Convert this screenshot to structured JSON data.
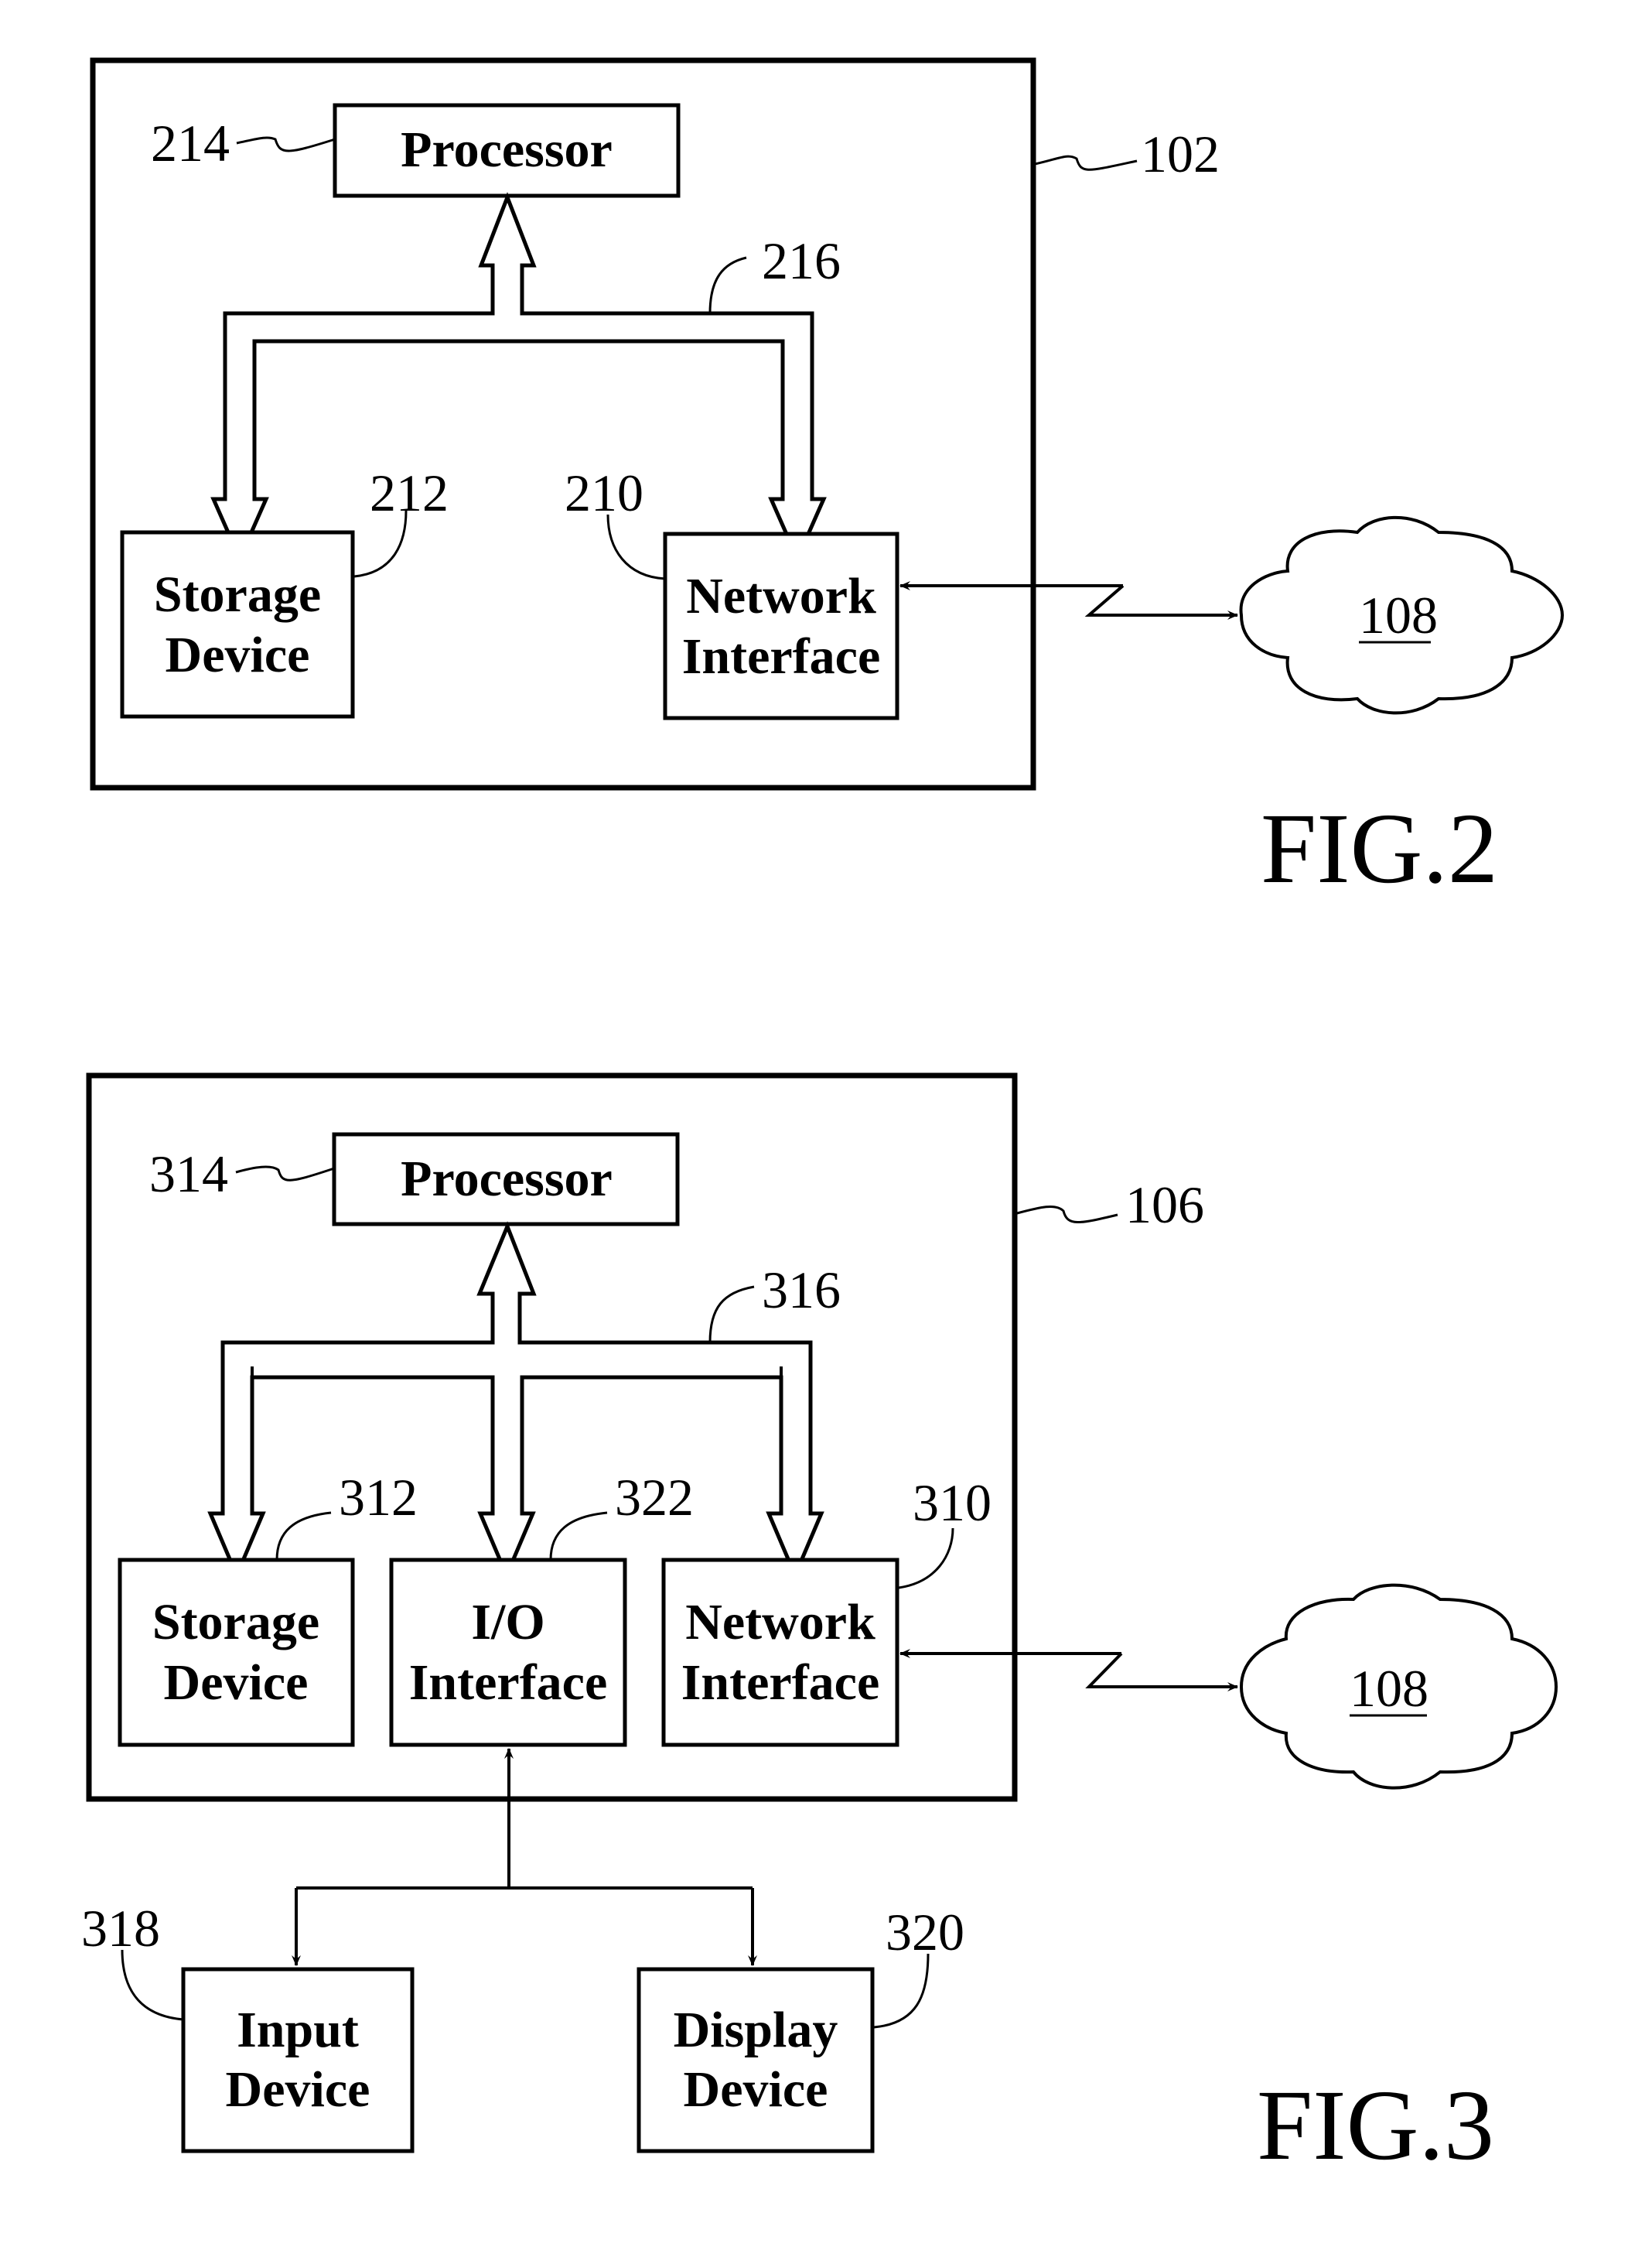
{
  "figures": [
    {
      "caption": "FIG.2",
      "system_ref": "102",
      "processor": {
        "label": "Processor",
        "ref": "214"
      },
      "bus_ref": "216",
      "storage": {
        "label_line1": "Storage",
        "label_line2": "Device",
        "ref": "212"
      },
      "network": {
        "label_line1": "Network",
        "label_line2": "Interface",
        "ref": "210"
      },
      "network_cloud_ref": "108"
    },
    {
      "caption": "FIG.3",
      "system_ref": "106",
      "processor": {
        "label": "Processor",
        "ref": "314"
      },
      "bus_ref": "316",
      "storage": {
        "label_line1": "Storage",
        "label_line2": "Device",
        "ref": "312"
      },
      "io": {
        "label_line1": "I/O",
        "label_line2": "Interface",
        "ref": "322"
      },
      "network": {
        "label_line1": "Network",
        "label_line2": "Interface",
        "ref": "310"
      },
      "network_cloud_ref": "108",
      "input": {
        "label_line1": "Input",
        "label_line2": "Device",
        "ref": "318"
      },
      "display": {
        "label_line1": "Display",
        "label_line2": "Device",
        "ref": "320"
      }
    }
  ]
}
